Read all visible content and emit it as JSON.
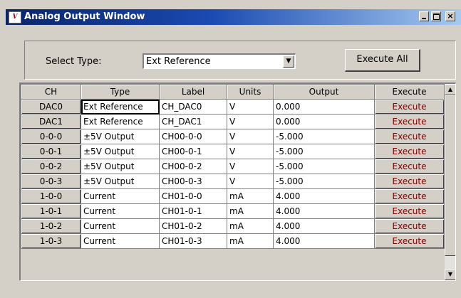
{
  "window": {
    "title": "Analog Output Window",
    "icon": "app-icon"
  },
  "toolbar": {
    "select_label": "Select Type:",
    "select_value": "Ext Reference",
    "execute_all_label": "Execute All"
  },
  "table": {
    "columns": [
      "CH",
      "Type",
      "Label",
      "Units",
      "Output",
      "Execute"
    ],
    "rows": [
      {
        "ch": "DAC0",
        "type": "Ext Reference",
        "label": "CH_DAC0",
        "units": "V",
        "output": "0.000",
        "execute": "Execute"
      },
      {
        "ch": "DAC1",
        "type": "Ext Reference",
        "label": "CH_DAC1",
        "units": "V",
        "output": "0.000",
        "execute": "Execute"
      },
      {
        "ch": "0-0-0",
        "type": "±5V Output",
        "label": "CH00-0-0",
        "units": "V",
        "output": "-5.000",
        "execute": "Execute"
      },
      {
        "ch": "0-0-1",
        "type": "±5V Output",
        "label": "CH00-0-1",
        "units": "V",
        "output": "-5.000",
        "execute": "Execute"
      },
      {
        "ch": "0-0-2",
        "type": "±5V Output",
        "label": "CH00-0-2",
        "units": "V",
        "output": "-5.000",
        "execute": "Execute"
      },
      {
        "ch": "0-0-3",
        "type": "±5V Output",
        "label": "CH00-0-3",
        "units": "V",
        "output": "-5.000",
        "execute": "Execute"
      },
      {
        "ch": "1-0-0",
        "type": "Current",
        "label": "CH01-0-0",
        "units": "mA",
        "output": "4.000",
        "execute": "Execute"
      },
      {
        "ch": "1-0-1",
        "type": "Current",
        "label": "CH01-0-1",
        "units": "mA",
        "output": "4.000",
        "execute": "Execute"
      },
      {
        "ch": "1-0-2",
        "type": "Current",
        "label": "CH01-0-2",
        "units": "mA",
        "output": "4.000",
        "execute": "Execute"
      },
      {
        "ch": "1-0-3",
        "type": "Current",
        "label": "CH01-0-3",
        "units": "mA",
        "output": "4.000",
        "execute": "Execute"
      }
    ]
  },
  "colors": {
    "title_bar_start": "#0a246a",
    "title_bar_end": "#a6caf0",
    "dialog_face": "#d4d0c8",
    "execute_text": "#800000"
  }
}
